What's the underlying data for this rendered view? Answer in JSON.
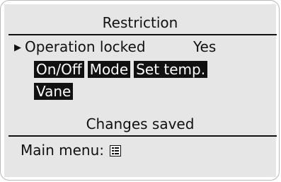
{
  "screen": {
    "title": "Restriction",
    "operation_row": {
      "cursor": "▶",
      "label": "Operation locked",
      "value": "Yes"
    },
    "locked_items": [
      "On/Off",
      "Mode",
      "Set temp.",
      "Vane"
    ],
    "status": "Changes saved",
    "footer": {
      "label": "Main menu:",
      "icon": "menu-list-icon"
    }
  },
  "colors": {
    "screen_bg": "#e6e6e6",
    "text": "#111111",
    "highlight_bg": "#111111",
    "highlight_text": "#ffffff"
  }
}
